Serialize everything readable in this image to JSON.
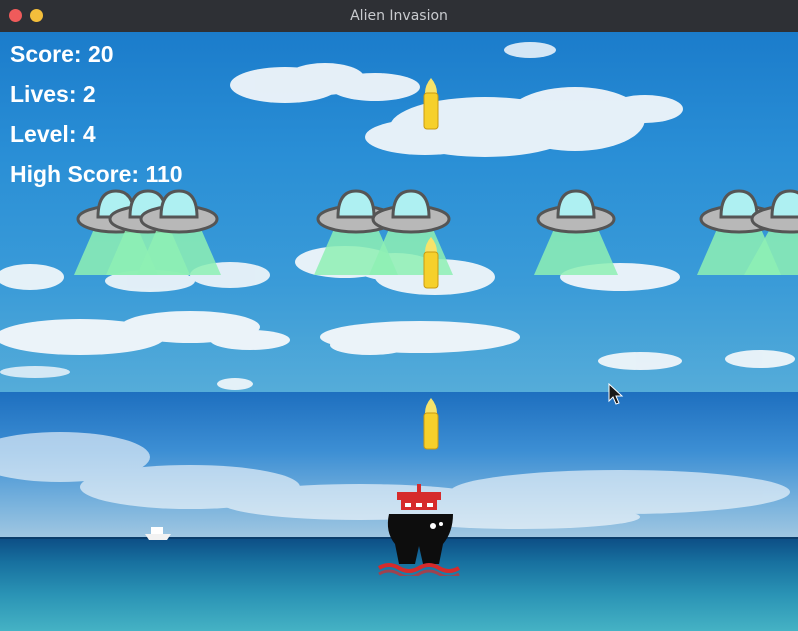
{
  "window": {
    "title": "Alien Invasion"
  },
  "hud": {
    "score_text": "Score: 20",
    "lives_text": "Lives: 2",
    "level_text": "Level: 4",
    "high_score_text": "High Score: 110"
  },
  "colors": {
    "hud_text": "#ffffff",
    "ufo_dome": "#aef0f2",
    "ufo_saucer": "#b8b8b8",
    "ufo_beam": "#8ef0b4",
    "bullet": "#f6d02b",
    "ship_body": "#0d0d0d",
    "ship_cabin": "#d62b2b"
  },
  "icons": {
    "alien": "ufo-icon",
    "player": "ship-icon",
    "bullet": "bullet-icon",
    "cursor": "mouse-pointer-icon"
  }
}
